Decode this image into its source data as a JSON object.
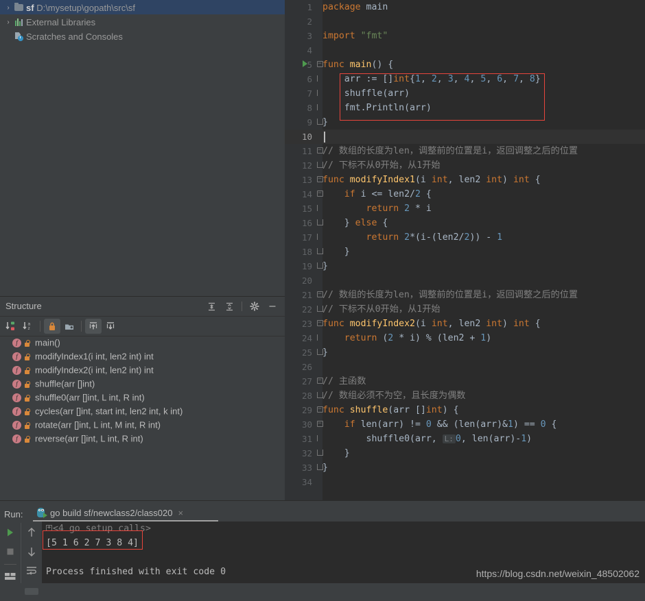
{
  "project_tree": {
    "items": [
      {
        "label_bold": "sf",
        "label_path": "D:\\mysetup\\gopath\\src\\sf",
        "icon": "folder-icon",
        "arrow": "›",
        "selected": true,
        "indent": 0
      },
      {
        "label_bold": "",
        "label_path": "External Libraries",
        "icon": "libraries-icon",
        "arrow": "›",
        "selected": false,
        "indent": 0
      },
      {
        "label_bold": "",
        "label_path": "Scratches and Consoles",
        "icon": "scratches-icon",
        "arrow": "",
        "selected": false,
        "indent": 0
      }
    ]
  },
  "structure": {
    "title": "Structure",
    "header_icons": [
      "expand-all-icon",
      "collapse-all-icon",
      "gear-icon",
      "minimize-icon"
    ],
    "toolbar_icons": [
      "sort-by-visibility-icon",
      "sort-alphabetically-icon",
      "show-non-public-icon",
      "group-icon",
      "scroll-from-source-icon",
      "scroll-to-source-icon"
    ],
    "items": [
      {
        "name": "main()"
      },
      {
        "name": "modifyIndex1(i int, len2 int) int"
      },
      {
        "name": "modifyIndex2(i int, len2 int) int"
      },
      {
        "name": "shuffle(arr []int)"
      },
      {
        "name": "shuffle0(arr []int, L int, R int)"
      },
      {
        "name": "cycles(arr []int, start int, len2 int, k int)"
      },
      {
        "name": "rotate(arr []int, L int, M int, R int)"
      },
      {
        "name": "reverse(arr []int, L int, R int)"
      }
    ]
  },
  "editor": {
    "first_line": 1,
    "last_line": 34,
    "current_line": 10,
    "run_marker_line": 5,
    "highlight_box_lines": [
      6,
      8
    ],
    "param_hint": "L:",
    "lines": [
      {
        "n": 1,
        "fold": "",
        "tokens": [
          {
            "t": "package ",
            "c": "kw"
          },
          {
            "t": "main",
            "c": "pl"
          }
        ]
      },
      {
        "n": 2,
        "fold": "",
        "tokens": []
      },
      {
        "n": 3,
        "fold": "",
        "tokens": [
          {
            "t": "import ",
            "c": "kw"
          },
          {
            "t": "\"fmt\"",
            "c": "str"
          }
        ]
      },
      {
        "n": 4,
        "fold": "",
        "tokens": []
      },
      {
        "n": 5,
        "fold": "open",
        "tokens": [
          {
            "t": "func ",
            "c": "kw"
          },
          {
            "t": "main",
            "c": "fn"
          },
          {
            "t": "() {",
            "c": "pl"
          }
        ]
      },
      {
        "n": 6,
        "fold": "line",
        "tokens": [
          {
            "t": "    arr := []",
            "c": "pl"
          },
          {
            "t": "int",
            "c": "kw"
          },
          {
            "t": "{",
            "c": "pl"
          },
          {
            "t": "1",
            "c": "num"
          },
          {
            "t": ", ",
            "c": "pl"
          },
          {
            "t": "2",
            "c": "num"
          },
          {
            "t": ", ",
            "c": "pl"
          },
          {
            "t": "3",
            "c": "num"
          },
          {
            "t": ", ",
            "c": "pl"
          },
          {
            "t": "4",
            "c": "num"
          },
          {
            "t": ", ",
            "c": "pl"
          },
          {
            "t": "5",
            "c": "num"
          },
          {
            "t": ", ",
            "c": "pl"
          },
          {
            "t": "6",
            "c": "num"
          },
          {
            "t": ", ",
            "c": "pl"
          },
          {
            "t": "7",
            "c": "num"
          },
          {
            "t": ", ",
            "c": "pl"
          },
          {
            "t": "8",
            "c": "num"
          },
          {
            "t": "}",
            "c": "pl"
          }
        ]
      },
      {
        "n": 7,
        "fold": "line",
        "tokens": [
          {
            "t": "    shuffle(arr)",
            "c": "pl"
          }
        ]
      },
      {
        "n": 8,
        "fold": "line",
        "tokens": [
          {
            "t": "    fmt.Println(arr)",
            "c": "pl"
          }
        ]
      },
      {
        "n": 9,
        "fold": "end",
        "tokens": [
          {
            "t": "}",
            "c": "pl"
          }
        ]
      },
      {
        "n": 10,
        "fold": "",
        "tokens": []
      },
      {
        "n": 11,
        "fold": "open",
        "tokens": [
          {
            "t": "// 数组的长度为len，调整前的位置是i，返回调整之后的位置",
            "c": "cmt"
          }
        ]
      },
      {
        "n": 12,
        "fold": "end",
        "tokens": [
          {
            "t": "// 下标不从0开始，从1开始",
            "c": "cmt"
          }
        ]
      },
      {
        "n": 13,
        "fold": "open",
        "tokens": [
          {
            "t": "func ",
            "c": "kw"
          },
          {
            "t": "modifyIndex1",
            "c": "fn"
          },
          {
            "t": "(i ",
            "c": "pl"
          },
          {
            "t": "int",
            "c": "kw"
          },
          {
            "t": ", len2 ",
            "c": "pl"
          },
          {
            "t": "int",
            "c": "kw"
          },
          {
            "t": ") ",
            "c": "pl"
          },
          {
            "t": "int",
            "c": "kw"
          },
          {
            "t": " {",
            "c": "pl"
          }
        ]
      },
      {
        "n": 14,
        "fold": "open",
        "tokens": [
          {
            "t": "    ",
            "c": "pl"
          },
          {
            "t": "if",
            "c": "kw"
          },
          {
            "t": " i <= len2/",
            "c": "pl"
          },
          {
            "t": "2",
            "c": "num"
          },
          {
            "t": " {",
            "c": "pl"
          }
        ]
      },
      {
        "n": 15,
        "fold": "line",
        "tokens": [
          {
            "t": "        ",
            "c": "pl"
          },
          {
            "t": "return",
            "c": "kw"
          },
          {
            "t": " ",
            "c": "pl"
          },
          {
            "t": "2",
            "c": "num"
          },
          {
            "t": " * i",
            "c": "pl"
          }
        ]
      },
      {
        "n": 16,
        "fold": "end",
        "tokens": [
          {
            "t": "    } ",
            "c": "pl"
          },
          {
            "t": "else",
            "c": "kw"
          },
          {
            "t": " {",
            "c": "pl"
          }
        ]
      },
      {
        "n": 17,
        "fold": "line",
        "tokens": [
          {
            "t": "        ",
            "c": "pl"
          },
          {
            "t": "return",
            "c": "kw"
          },
          {
            "t": " ",
            "c": "pl"
          },
          {
            "t": "2",
            "c": "num"
          },
          {
            "t": "*(i-(len2/",
            "c": "pl"
          },
          {
            "t": "2",
            "c": "num"
          },
          {
            "t": ")) - ",
            "c": "pl"
          },
          {
            "t": "1",
            "c": "num"
          }
        ]
      },
      {
        "n": 18,
        "fold": "end",
        "tokens": [
          {
            "t": "    }",
            "c": "pl"
          }
        ]
      },
      {
        "n": 19,
        "fold": "end",
        "tokens": [
          {
            "t": "}",
            "c": "pl"
          }
        ]
      },
      {
        "n": 20,
        "fold": "",
        "tokens": []
      },
      {
        "n": 21,
        "fold": "open",
        "tokens": [
          {
            "t": "// 数组的长度为len，调整前的位置是i，返回调整之后的位置",
            "c": "cmt"
          }
        ]
      },
      {
        "n": 22,
        "fold": "end",
        "tokens": [
          {
            "t": "// 下标不从0开始，从1开始",
            "c": "cmt"
          }
        ]
      },
      {
        "n": 23,
        "fold": "open",
        "tokens": [
          {
            "t": "func ",
            "c": "kw"
          },
          {
            "t": "modifyIndex2",
            "c": "fn"
          },
          {
            "t": "(i ",
            "c": "pl"
          },
          {
            "t": "int",
            "c": "kw"
          },
          {
            "t": ", len2 ",
            "c": "pl"
          },
          {
            "t": "int",
            "c": "kw"
          },
          {
            "t": ") ",
            "c": "pl"
          },
          {
            "t": "int",
            "c": "kw"
          },
          {
            "t": " {",
            "c": "pl"
          }
        ]
      },
      {
        "n": 24,
        "fold": "line",
        "tokens": [
          {
            "t": "    ",
            "c": "pl"
          },
          {
            "t": "return",
            "c": "kw"
          },
          {
            "t": " (",
            "c": "pl"
          },
          {
            "t": "2",
            "c": "num"
          },
          {
            "t": " * i) % (len2 + ",
            "c": "pl"
          },
          {
            "t": "1",
            "c": "num"
          },
          {
            "t": ")",
            "c": "pl"
          }
        ]
      },
      {
        "n": 25,
        "fold": "end",
        "tokens": [
          {
            "t": "}",
            "c": "pl"
          }
        ]
      },
      {
        "n": 26,
        "fold": "",
        "tokens": []
      },
      {
        "n": 27,
        "fold": "open",
        "tokens": [
          {
            "t": "// 主函数",
            "c": "cmt"
          }
        ]
      },
      {
        "n": 28,
        "fold": "end",
        "tokens": [
          {
            "t": "// 数组必须不为空，且长度为偶数",
            "c": "cmt"
          }
        ]
      },
      {
        "n": 29,
        "fold": "open",
        "tokens": [
          {
            "t": "func ",
            "c": "kw"
          },
          {
            "t": "shuffle",
            "c": "fn"
          },
          {
            "t": "(arr []",
            "c": "pl"
          },
          {
            "t": "int",
            "c": "kw"
          },
          {
            "t": ") {",
            "c": "pl"
          }
        ]
      },
      {
        "n": 30,
        "fold": "open",
        "tokens": [
          {
            "t": "    ",
            "c": "pl"
          },
          {
            "t": "if",
            "c": "kw"
          },
          {
            "t": " len(arr) != ",
            "c": "pl"
          },
          {
            "t": "0",
            "c": "num"
          },
          {
            "t": " && (len(arr)&",
            "c": "pl"
          },
          {
            "t": "1",
            "c": "num"
          },
          {
            "t": ") == ",
            "c": "pl"
          },
          {
            "t": "0",
            "c": "num"
          },
          {
            "t": " {",
            "c": "pl"
          }
        ]
      },
      {
        "n": 31,
        "fold": "line",
        "tokens": [
          {
            "t": "        shuffle0(arr, ",
            "c": "pl"
          },
          {
            "t": "@HINT@",
            "c": "hint"
          },
          {
            "t": "0",
            "c": "num"
          },
          {
            "t": ", len(arr)-",
            "c": "pl"
          },
          {
            "t": "1",
            "c": "num"
          },
          {
            "t": ")",
            "c": "pl"
          }
        ]
      },
      {
        "n": 32,
        "fold": "end",
        "tokens": [
          {
            "t": "    }",
            "c": "pl"
          }
        ]
      },
      {
        "n": 33,
        "fold": "end",
        "tokens": [
          {
            "t": "}",
            "c": "pl"
          }
        ]
      },
      {
        "n": 34,
        "fold": "",
        "tokens": []
      }
    ]
  },
  "run_panel": {
    "run_label": "Run:",
    "tab_name": "go build sf/newclass2/class020",
    "tab_close": "×",
    "toolbar_icons": [
      "rerun-icon",
      "stop-icon",
      "layout-icon",
      "scroll-up-icon",
      "scroll-down-icon",
      "soft-wrap-icon"
    ],
    "console_lines": [
      {
        "fold": "+",
        "text": "<4 go setup calls>",
        "style": "gray"
      },
      {
        "fold": "",
        "text": "[5 1 6 2 7 3 8 4]",
        "style": "normal"
      },
      {
        "fold": "",
        "text": "",
        "style": "normal"
      },
      {
        "fold": "",
        "text": "Process finished with exit code 0",
        "style": "normal"
      }
    ],
    "output_array": [
      5,
      1,
      6,
      2,
      7,
      3,
      8,
      4
    ],
    "exit_code": 0
  },
  "watermark": "https://blog.csdn.net/weixin_48502062",
  "colors": {
    "editor_bg": "#2b2b2b",
    "gutter_bg": "#313335",
    "panel_bg": "#3c3f41",
    "selection_blue": "#2f4463",
    "highlight_red": "#e8453c",
    "keyword_orange": "#cc7832",
    "function_yellow": "#ffc66d",
    "string_green": "#6a8759",
    "number_blue": "#6897bb",
    "comment_gray": "#808080",
    "plain_text": "#a9b7c6"
  }
}
